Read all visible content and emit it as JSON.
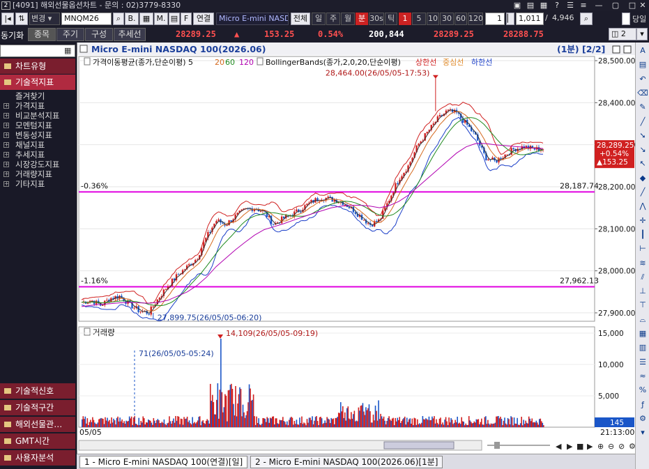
{
  "window": {
    "title": "[4091] 해외선물옵션차트 - 문의 : 02)3779-8330",
    "app_icon": "2",
    "dangil_label": "당일"
  },
  "toolbar": {
    "mode_select": "변경",
    "symbol": "MNQM26",
    "type_buttons": [
      "B",
      "M",
      "F"
    ],
    "linked_label": "연결",
    "product_name": "Micro E-mini NASDAQ",
    "periods": [
      "전체",
      "일",
      "주",
      "월",
      "분",
      "30s",
      "틱"
    ],
    "active_period": "분",
    "interval_buttons": [
      "1",
      "5",
      "10",
      "30",
      "60",
      "120"
    ],
    "active_interval": "1",
    "count_value": "1",
    "position": "1,011",
    "total": "4,946"
  },
  "toolbar2": {
    "sync_label": "동기화",
    "tabs": [
      "종목",
      "주기",
      "구성",
      "추세선"
    ],
    "last_price": "28289.25",
    "change": "153.25",
    "change_pct": "0.54%",
    "volume": "200,844",
    "bid": "28289.25",
    "ask": "28288.75",
    "layout_count": "2"
  },
  "sidebar": {
    "top_items": [
      "차트유형",
      "기술적지표"
    ],
    "tree": [
      "즐겨찾기",
      "가격지표",
      "비교분석지표",
      "모멘텀지표",
      "변동성지표",
      "채널지표",
      "추세지표",
      "시장강도지표",
      "거래량지표",
      "기타지표"
    ],
    "bottom_items": [
      "기술적신호",
      "기술적구간",
      "해외선물관…",
      "GMT시간",
      "사용자분석"
    ]
  },
  "chart": {
    "title": "Micro E-mini NASDAQ 100(2026.06)",
    "interval_tag": "(1분) [2/2]",
    "legend_ma": "가격이동평균(종가,단순이평) 5",
    "ma_periods": [
      "20",
      "60",
      "120"
    ],
    "legend_bb": "BollingerBands(종가,2,0,20,단순이평)",
    "bb_lines": [
      "상한선",
      "중심선",
      "하한선"
    ],
    "high_note": "28,464.00(26/05/05-17:53)",
    "low_note": "27,899.75(26/05/05-06:20)",
    "hline1_left": "-0.36%",
    "hline1_right": "28,187.74",
    "hline2_left": "-1.16%",
    "hline2_right": "27,962.13",
    "price_ticks": [
      "28,500.00",
      "28,400.00",
      "28,300.00",
      "28,200.00",
      "28,100.00",
      "28,000.00",
      "27,900.00"
    ],
    "cur_price": "28,289.25",
    "cur_pct": "+0.54%",
    "cur_chg": "▲153.25",
    "volume_title": "거래량",
    "vol_max_note": "14,109(26/05/05-09:19)",
    "vol_min_note": "71(26/05/05-05:24)",
    "vol_ticks": [
      "15,000",
      "10,000",
      "5,000"
    ],
    "vol_cur": "145",
    "date_start": "05/05",
    "time_end": "21:13:00"
  },
  "chart_data": {
    "type": "line",
    "title": "Micro E-mini NASDAQ 100(2026.06)",
    "xlabel": "",
    "ylabel": "",
    "x_range": [
      "05/05",
      "21:13:00"
    ],
    "ylim": [
      27880,
      28510
    ],
    "series": [
      {
        "name": "가격",
        "values": [
          27925,
          27930,
          27918,
          27935,
          27940,
          27920,
          27905,
          27900,
          27935,
          27965,
          27990,
          28010,
          28030,
          28080,
          28120,
          28110,
          28130,
          28145,
          28150,
          28140,
          28110,
          28125,
          28135,
          28150,
          28165,
          28175,
          28170,
          28165,
          28150,
          28130,
          28110,
          28120,
          28170,
          28220,
          28250,
          28300,
          28330,
          28360,
          28380,
          28375,
          28350,
          28320,
          28270,
          28260,
          28275,
          28290,
          28295,
          28290,
          28290
        ]
      },
      {
        "name": "120",
        "values": [
          27915,
          27918,
          27920,
          27922,
          27924,
          27925,
          27924,
          27923,
          27925,
          27930,
          27940,
          27950,
          27965,
          27985,
          28010,
          28030,
          28050,
          28068,
          28085,
          28098,
          28105,
          28112,
          28120,
          28128,
          28136,
          28143,
          28150,
          28154,
          28156,
          28156,
          28154,
          28150,
          28155,
          28165,
          28180,
          28200,
          28220,
          28240,
          28260,
          28280,
          28295,
          28303,
          28303,
          28300,
          28298,
          28296,
          28294,
          28292,
          28291
        ]
      }
    ],
    "volume": {
      "max": 14109,
      "min": 71,
      "ylim": [
        0,
        16000
      ]
    },
    "hlines": [
      28187.74,
      27962.13
    ]
  },
  "bottom_tabs": [
    "1 - Micro E-mini NASDAQ 100(연결)[일]",
    "2 - Micro E-mini NASDAQ 100(2026.06)[1분]"
  ],
  "colors": {
    "up": "#d02020",
    "down": "#1a56c8",
    "ma20": "#d4691e",
    "ma60": "#1f8a1f",
    "ma120": "#b100b1",
    "hline": "#e000e0"
  }
}
